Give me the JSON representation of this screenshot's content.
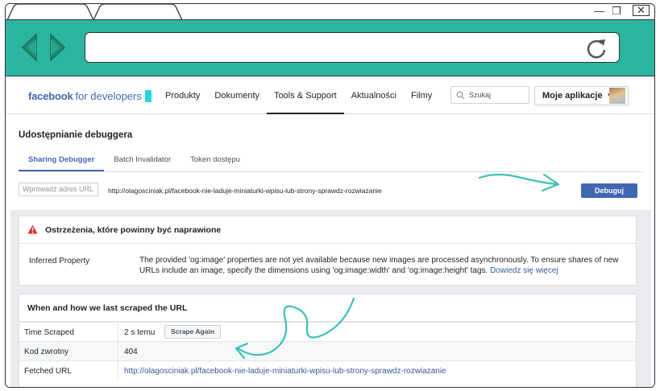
{
  "browser": {
    "controls": {
      "minimize": "—",
      "maximize": "❐",
      "close": "✕"
    }
  },
  "header": {
    "logo_brand": "facebook",
    "logo_suffix": "for developers",
    "nav": [
      "Produkty",
      "Dokumenty",
      "Tools & Support",
      "Aktualności",
      "Filmy"
    ],
    "search_placeholder": "Szukaj",
    "my_apps": "Moje aplikacje"
  },
  "page": {
    "title": "Udostępnianie debuggera",
    "tabs": [
      "Sharing Debugger",
      "Batch Invalidator",
      "Token dostępu"
    ],
    "input_placeholder": "Wprowadź adres URL",
    "url": "http://olagosciniak.pl/facebook-nie-laduje-miniaturki-wpisu-lub-strony-sprawdz-rozwiazanie",
    "debug_button": "Debuguj"
  },
  "warnings": {
    "title": "Ostrzeżenia, które powinny być naprawione",
    "property": "Inferred Property",
    "message": "The provided 'og:image' properties are not yet available because new images are processed asynchronously. To ensure shares of new URLs include an image, specify the dimensions using 'og:image:width' and 'og:image:height' tags.",
    "link": "Dowiedz się więcej"
  },
  "scrape": {
    "title": "When and how we last scraped the URL",
    "time_label": "Time Scraped",
    "time_value": "2 s temu",
    "scrape_button": "Scrape Again",
    "code_label": "Kod zwrotny",
    "code_value": "404",
    "fetched_label": "Fetched URL",
    "fetched_value": "http://olagosciniak.pl/facebook-nie-laduje-miniaturki-wpisu-lub-strony-sprawdz-rozwiazanie"
  },
  "colors": {
    "teal": "#2bb5a1",
    "facebook_blue": "#4267b2",
    "link_blue": "#365899",
    "warning_red": "#e02a2a",
    "annotation": "#3cc2b4"
  }
}
